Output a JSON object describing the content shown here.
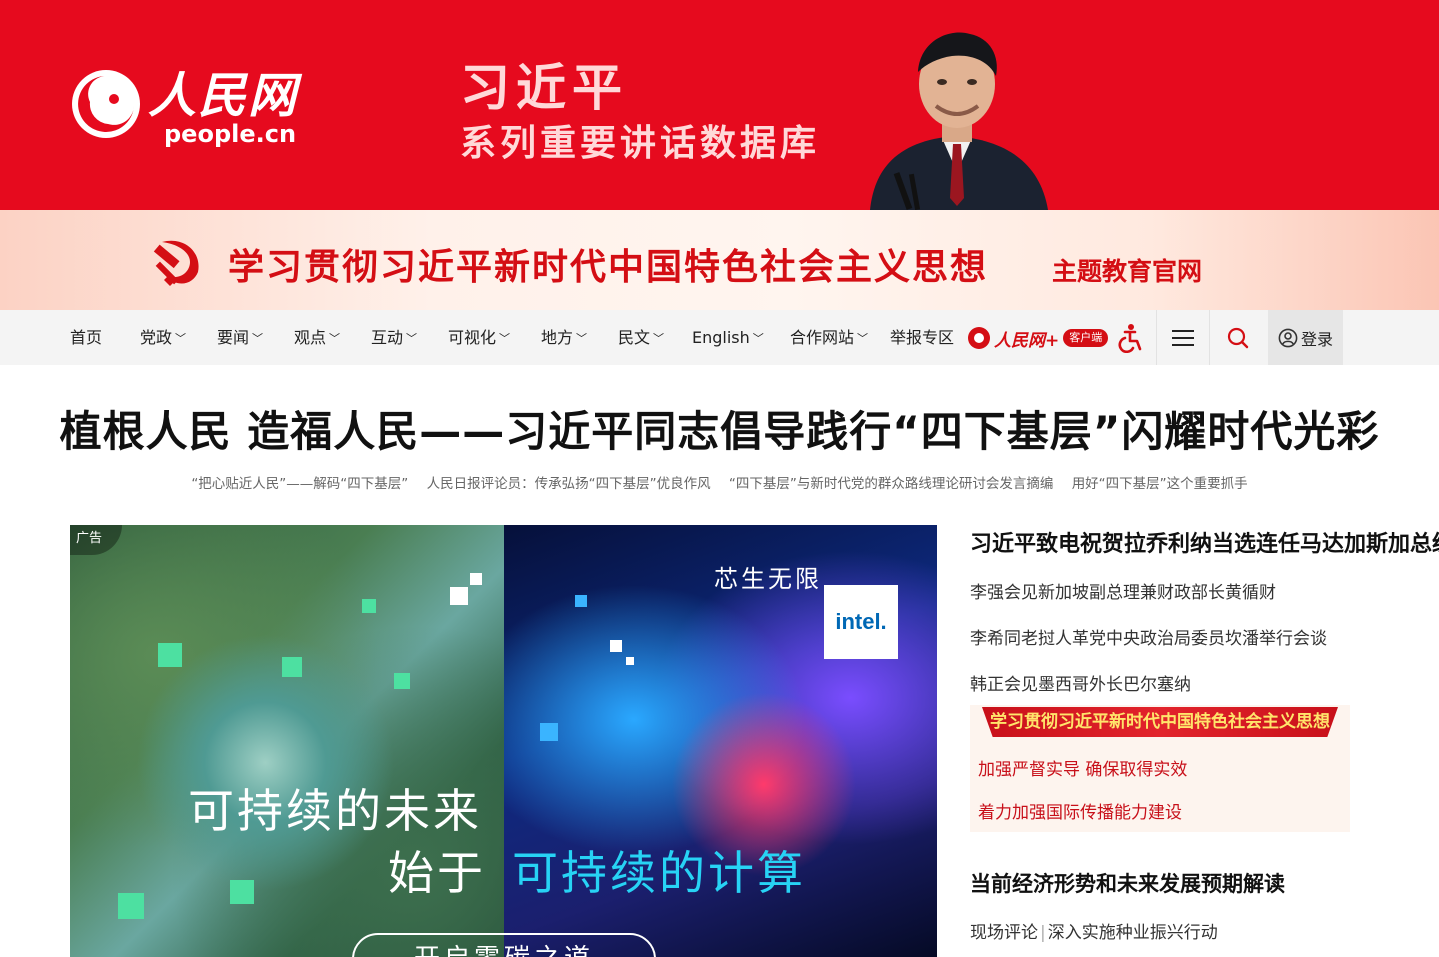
{
  "brand": {
    "name": "人民网",
    "domain": "people.cn"
  },
  "promo": {
    "title": "习近平",
    "subtitle": "系列重要讲话数据库"
  },
  "theme_banner": {
    "main": "学习贯彻习近平新时代中国特色社会主义思想",
    "tail": "主题教育官网"
  },
  "nav": {
    "items": [
      {
        "label": "首页",
        "dropdown": false
      },
      {
        "label": "党政",
        "dropdown": true
      },
      {
        "label": "要闻",
        "dropdown": true
      },
      {
        "label": "观点",
        "dropdown": true
      },
      {
        "label": "互动",
        "dropdown": true
      },
      {
        "label": "可视化",
        "dropdown": true
      },
      {
        "label": "地方",
        "dropdown": true
      },
      {
        "label": "民文",
        "dropdown": true
      },
      {
        "label": "English",
        "dropdown": true
      },
      {
        "label": "合作网站",
        "dropdown": true
      },
      {
        "label": "举报专区",
        "dropdown": false
      }
    ],
    "app_name": "人民网+",
    "app_badge": "客户端",
    "login_label": "登录"
  },
  "headline": {
    "title": "植根人民 造福人民——习近平同志倡导践行“四下基层”闪耀时代光彩",
    "sub_links": [
      "“把心贴近人民”——解码“四下基层”",
      "人民日报评论员：传承弘扬“四下基层”优良作风",
      "“四下基层”与新时代党的群众路线理论研讨会发言摘编",
      "用好“四下基层”这个重要抓手"
    ]
  },
  "ad": {
    "tag": "广告",
    "slogan": "芯生无限",
    "brand": "intel.",
    "line1": "可持续的未来",
    "line2_prefix": "始于",
    "line2_highlight": "可持续的计算",
    "cta": "开启零碳之道"
  },
  "right_column": {
    "top_news": "习近平致电祝贺拉乔利纳当选连任马达加斯加总统",
    "news": [
      "李强会见新加坡副总理兼财政部长黄循财",
      "李希同老挝人革党中央政治局委员坎潘举行会谈",
      "韩正会见墨西哥外长巴尔塞纳"
    ],
    "study": {
      "banner": "学习贯彻习近平新时代中国特色社会主义思想",
      "items": [
        "加强严督实导 确保取得实效",
        "着力加强国际传播能力建设"
      ]
    },
    "econ": {
      "title": "当前经济形势和未来发展预期解读",
      "links": [
        "现场评论",
        "深入实施种业振兴行动"
      ]
    }
  },
  "colors": {
    "brand_red": "#e60a1e",
    "theme_red": "#d40e14",
    "ad_cyan": "#27d3f5"
  }
}
